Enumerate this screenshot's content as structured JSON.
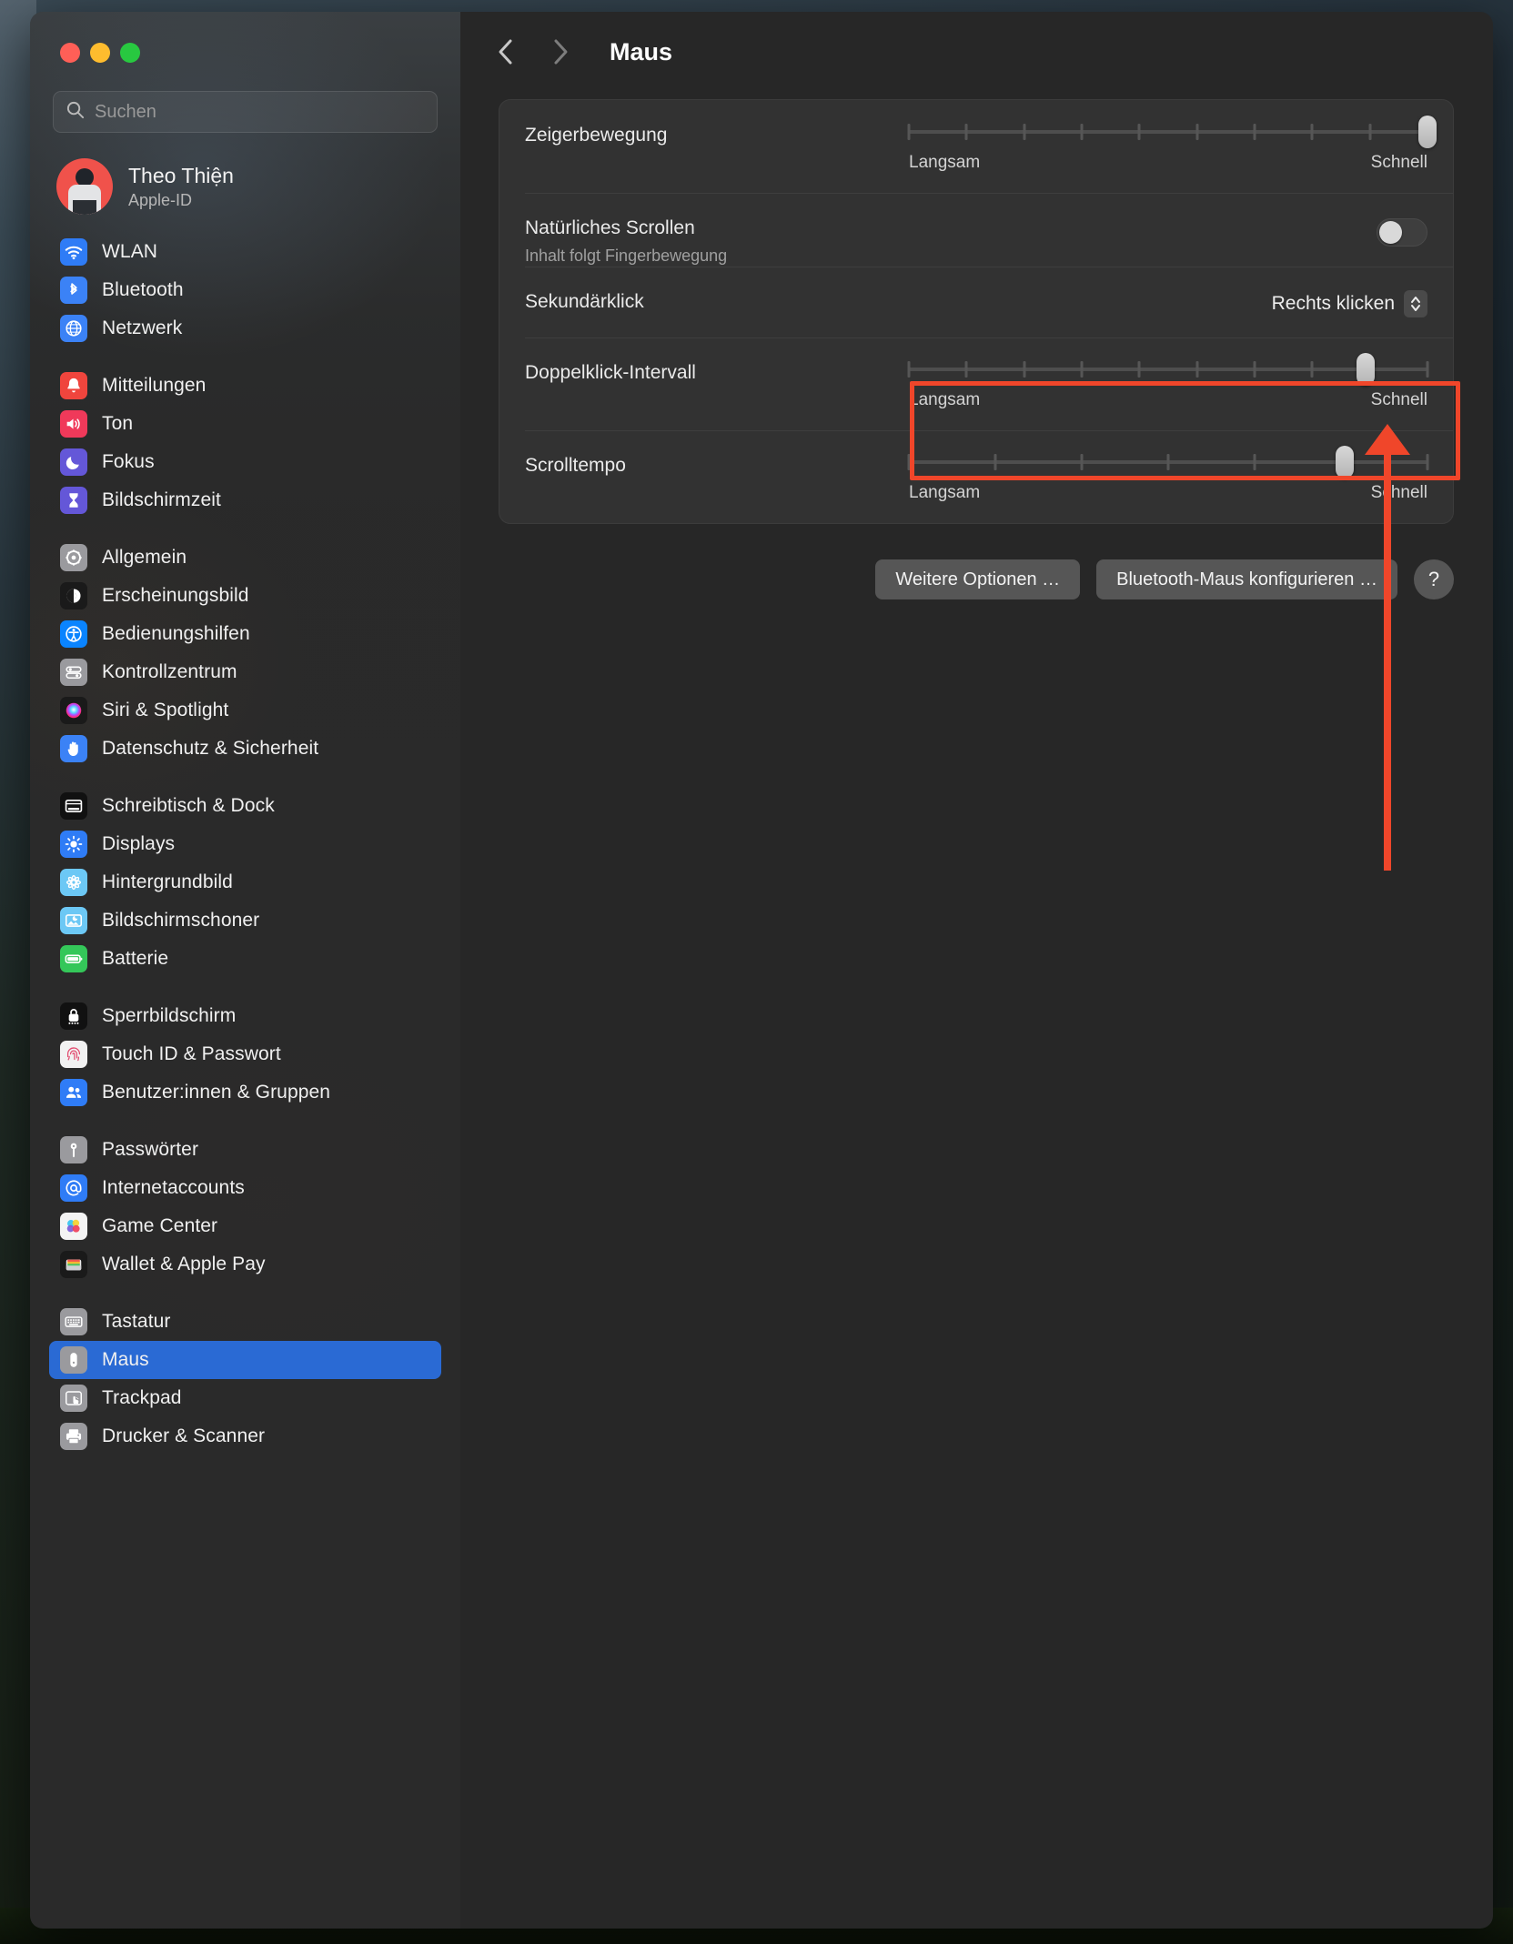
{
  "window": {
    "traffic_lights": [
      {
        "name": "close-button",
        "color": "#ff5f57"
      },
      {
        "name": "minimize-button",
        "color": "#febc2e"
      },
      {
        "name": "zoom-button",
        "color": "#28c840"
      }
    ]
  },
  "sidebar": {
    "search": {
      "placeholder": "Suchen",
      "value": ""
    },
    "profile": {
      "name": "Theo Thiện",
      "subtitle": "Apple-ID"
    },
    "groups": [
      {
        "items": [
          {
            "label": "WLAN",
            "icon": "wifi-icon",
            "tile": "#2f7cf6",
            "selected": false
          },
          {
            "label": "Bluetooth",
            "icon": "bluetooth-icon",
            "tile": "#3b82f6",
            "selected": false
          },
          {
            "label": "Netzwerk",
            "icon": "globe-icon",
            "tile": "#3b82f6",
            "selected": false
          }
        ]
      },
      {
        "items": [
          {
            "label": "Mitteilungen",
            "icon": "bell-icon",
            "tile": "#f0453d",
            "selected": false
          },
          {
            "label": "Ton",
            "icon": "speaker-icon",
            "tile": "#f0395a",
            "selected": false
          },
          {
            "label": "Fokus",
            "icon": "moon-icon",
            "tile": "#6457d8",
            "selected": false
          },
          {
            "label": "Bildschirmzeit",
            "icon": "hourglass-icon",
            "tile": "#6457d8",
            "selected": false
          }
        ]
      },
      {
        "items": [
          {
            "label": "Allgemein",
            "icon": "gear-icon",
            "tile": "#9a9a9e",
            "selected": false
          },
          {
            "label": "Erscheinungsbild",
            "icon": "appearance-icon",
            "tile": "#1a1a1a",
            "selected": false
          },
          {
            "label": "Bedienungshilfen",
            "icon": "accessibility-icon",
            "tile": "#0a84ff",
            "selected": false
          },
          {
            "label": "Kontrollzentrum",
            "icon": "control-center-icon",
            "tile": "#9a9a9e",
            "selected": false
          },
          {
            "label": "Siri & Spotlight",
            "icon": "siri-icon",
            "tile": "#1a1a1a",
            "selected": false
          },
          {
            "label": "Datenschutz & Sicherheit",
            "icon": "hand-icon",
            "tile": "#3b82f6",
            "selected": false
          }
        ]
      },
      {
        "items": [
          {
            "label": "Schreibtisch & Dock",
            "icon": "desktop-dock-icon",
            "tile": "#111111",
            "selected": false
          },
          {
            "label": "Displays",
            "icon": "brightness-icon",
            "tile": "#2f7cf6",
            "selected": false
          },
          {
            "label": "Hintergrundbild",
            "icon": "wallpaper-icon",
            "tile": "#6cc8f5",
            "selected": false
          },
          {
            "label": "Bildschirmschoner",
            "icon": "screensaver-icon",
            "tile": "#6cc8f5",
            "selected": false
          },
          {
            "label": "Batterie",
            "icon": "battery-icon",
            "tile": "#34c759",
            "selected": false
          }
        ]
      },
      {
        "items": [
          {
            "label": "Sperrbildschirm",
            "icon": "lock-icon",
            "tile": "#111111",
            "selected": false
          },
          {
            "label": "Touch ID & Passwort",
            "icon": "fingerprint-icon",
            "tile": "#f2f2f2",
            "selected": false
          },
          {
            "label": "Benutzer:innen & Gruppen",
            "icon": "users-icon",
            "tile": "#2f7cf6",
            "selected": false
          }
        ]
      },
      {
        "items": [
          {
            "label": "Passwörter",
            "icon": "key-icon",
            "tile": "#9a9a9e",
            "selected": false
          },
          {
            "label": "Internetaccounts",
            "icon": "at-icon",
            "tile": "#2f7cf6",
            "selected": false
          },
          {
            "label": "Game Center",
            "icon": "game-center-icon",
            "tile": "#f4f4f4",
            "selected": false
          },
          {
            "label": "Wallet & Apple Pay",
            "icon": "wallet-icon",
            "tile": "#1a1a1a",
            "selected": false
          }
        ]
      },
      {
        "items": [
          {
            "label": "Tastatur",
            "icon": "keyboard-icon",
            "tile": "#9a9a9e",
            "selected": false
          },
          {
            "label": "Maus",
            "icon": "mouse-icon",
            "tile": "#9a9a9e",
            "selected": true
          },
          {
            "label": "Trackpad",
            "icon": "trackpad-icon",
            "tile": "#9a9a9e",
            "selected": false
          },
          {
            "label": "Drucker & Scanner",
            "icon": "printer-icon",
            "tile": "#9a9a9e",
            "selected": false
          }
        ]
      }
    ]
  },
  "main": {
    "toolbar": {
      "back": "‹",
      "forward": "›",
      "title": "Maus"
    },
    "rows": {
      "pointer_speed": {
        "label": "Zeigerbewegung",
        "min_label": "Langsam",
        "max_label": "Schnell",
        "ticks": 10,
        "value_percent": 100
      },
      "natural_scrolling": {
        "label": "Natürliches Scrollen",
        "sublabel": "Inhalt folgt Fingerbewegung",
        "state": "off"
      },
      "secondary_click": {
        "label": "Sekundärklick",
        "value": "Rechts klicken"
      },
      "double_click": {
        "label": "Doppelklick-Intervall",
        "min_label": "Langsam",
        "max_label": "Schnell",
        "ticks": 10,
        "value_percent": 88
      },
      "scroll_speed": {
        "label": "Scrolltempo",
        "min_label": "Langsam",
        "max_label": "Schnell",
        "ticks": 7,
        "value_percent": 84
      }
    },
    "buttons": {
      "more_options": "Weitere Optionen …",
      "configure_bluetooth_mouse": "Bluetooth-Maus konfigurieren …",
      "help": "?"
    }
  },
  "annotation": {
    "highlight_color": "#f0462a",
    "target": "Doppelklick-Intervall"
  }
}
